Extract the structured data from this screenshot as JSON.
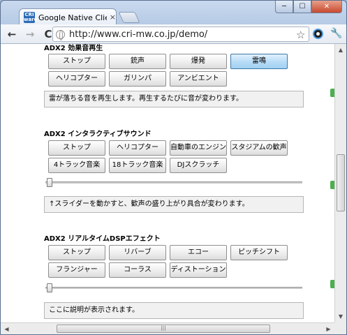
{
  "tab": {
    "favicon_text": "CRI\nware",
    "title": "Google Native Clientデモ",
    "close": "×"
  },
  "window_controls": {
    "minimize": "─",
    "maximize": "☐",
    "close": "✕"
  },
  "toolbar": {
    "back": "←",
    "forward": "→",
    "reload": "C",
    "url": "http://www.cri-mw.co.jp/demo/",
    "star": "☆",
    "wrench": "🔧"
  },
  "sections": {
    "se": {
      "heading": "ADX2 効果音再生",
      "buttons": [
        "ストップ",
        "銃声",
        "爆発",
        "雷鳴",
        "ヘリコプター",
        "ガリンパ",
        "アンビエント"
      ],
      "active_button": "雷鳴",
      "description": "雷が落ちる音を再生します。再生するたびに音が変わります。"
    },
    "interactive": {
      "heading": "ADX2 インタラクティブサウンド",
      "buttons": [
        "ストップ",
        "ヘリコプター",
        "自動車のエンジン",
        "スタジアムの歓声",
        "4トラック音楽",
        "18トラック音楽",
        "DJスクラッチ"
      ],
      "slider_value": 0,
      "description": "↑スライダーを動かすと、歓声の盛り上がり具合が変わります。"
    },
    "dsp": {
      "heading": "ADX2 リアルタイムDSPエフェクト",
      "buttons": [
        "ストップ",
        "リバーブ",
        "エコー",
        "ピッチシフト",
        "フランジャー",
        "コーラス",
        "ディストーション"
      ],
      "slider_value": 0,
      "description": "ここに説明が表示されます。"
    }
  },
  "scrollbars": {
    "up": "▲",
    "down": "▼",
    "left": "◀",
    "right": "▶",
    "grip": "|||"
  },
  "colors": {
    "active_button": "#a3d0f2",
    "accent_green": "#4caf50"
  }
}
